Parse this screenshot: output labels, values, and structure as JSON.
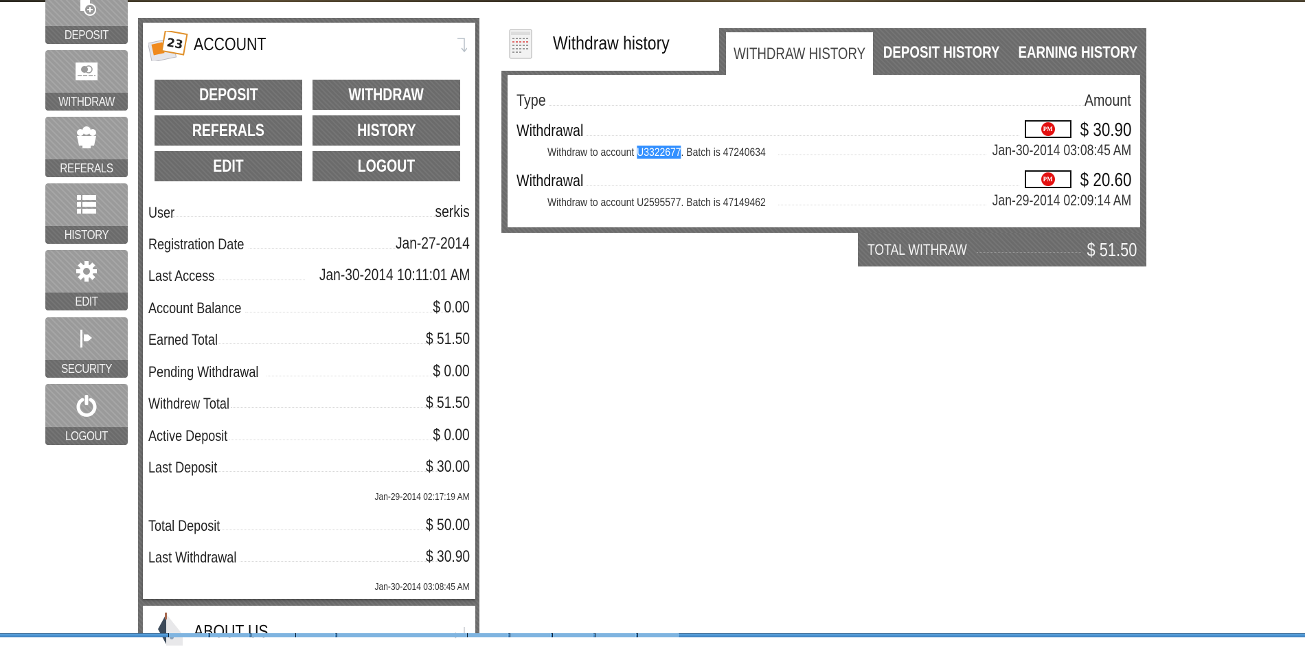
{
  "sidebar": {
    "items": [
      {
        "label": "DEPOSIT",
        "icon": "deposit-add-icon"
      },
      {
        "label": "WITHDRAW",
        "icon": "card-icon"
      },
      {
        "label": "REFERALS",
        "icon": "people-icon"
      },
      {
        "label": "HISTORY",
        "icon": "list-icon"
      },
      {
        "label": "EDIT",
        "icon": "gear-icon"
      },
      {
        "label": "SECURITY",
        "icon": "flag-icon"
      },
      {
        "label": "LOGOUT",
        "icon": "power-icon"
      }
    ]
  },
  "account": {
    "title": "ACCOUNT",
    "icon": "calendar-contact-icon",
    "collapse_icon": "arrow-down-icon",
    "buttons": [
      "DEPOSIT",
      "WITHDRAW",
      "REFERALS",
      "HISTORY",
      "EDIT",
      "LOGOUT"
    ],
    "rows": [
      {
        "label": "User",
        "value": "serkis"
      },
      {
        "label": "Registration Date",
        "value": "Jan-27-2014"
      },
      {
        "label": "Last Access",
        "value": "Jan-30-2014 10:11:01 AM"
      },
      {
        "label": "Account Balance",
        "value": "$ 0.00"
      },
      {
        "label": "Earned Total",
        "value": "$ 51.50"
      },
      {
        "label": "Pending Withdrawal",
        "value": "$ 0.00"
      },
      {
        "label": "Withdrew Total",
        "value": "$ 51.50"
      },
      {
        "label": "Active Deposit",
        "value": "$ 0.00"
      },
      {
        "label": "Last Deposit",
        "value": "$ 30.00",
        "sub": "Jan-29-2014 02:17:19 AM"
      },
      {
        "label": "Total Deposit",
        "value": "$ 50.00"
      },
      {
        "label": "Last Withdrawal",
        "value": "$ 30.90",
        "sub": "Jan-30-2014 03:08:45 AM"
      }
    ]
  },
  "about": {
    "title": "ABOUT US",
    "icon": "house-icon",
    "expand_icon": "return-arrow-icon"
  },
  "history": {
    "title": "Withdraw history",
    "icon": "calendar-icon",
    "tabs": [
      {
        "label": "WITHDRAW HISTORY",
        "active": true
      },
      {
        "label": "DEPOSIT HISTORY",
        "active": false
      },
      {
        "label": "EARNING HISTORY",
        "active": false
      }
    ],
    "columns": {
      "type": "Type",
      "amount": "Amount"
    },
    "rows": [
      {
        "type": "Withdrawal",
        "processor": "PM",
        "amount": "$ 30.90",
        "desc_prefix": "Withdraw to account ",
        "account": "U3322677",
        "desc_suffix": ". Batch is 47240634",
        "date": "Jan-30-2014 03:08:45 AM",
        "account_selected": true
      },
      {
        "type": "Withdrawal",
        "processor": "PM",
        "amount": "$ 20.60",
        "desc_prefix": "Withdraw to account ",
        "account": "U2595577",
        "desc_suffix": ". Batch is 47149462",
        "date": "Jan-29-2014 02:09:14 AM",
        "account_selected": false
      }
    ],
    "total": {
      "label": "TOTAL WITHRAW",
      "value": "$ 51.50"
    }
  },
  "colors": {
    "panel_gray": "#6b6b6b",
    "tile_gray": "#9a9a9a",
    "selection_blue": "#3390ff",
    "pm_red": "#e31010"
  }
}
